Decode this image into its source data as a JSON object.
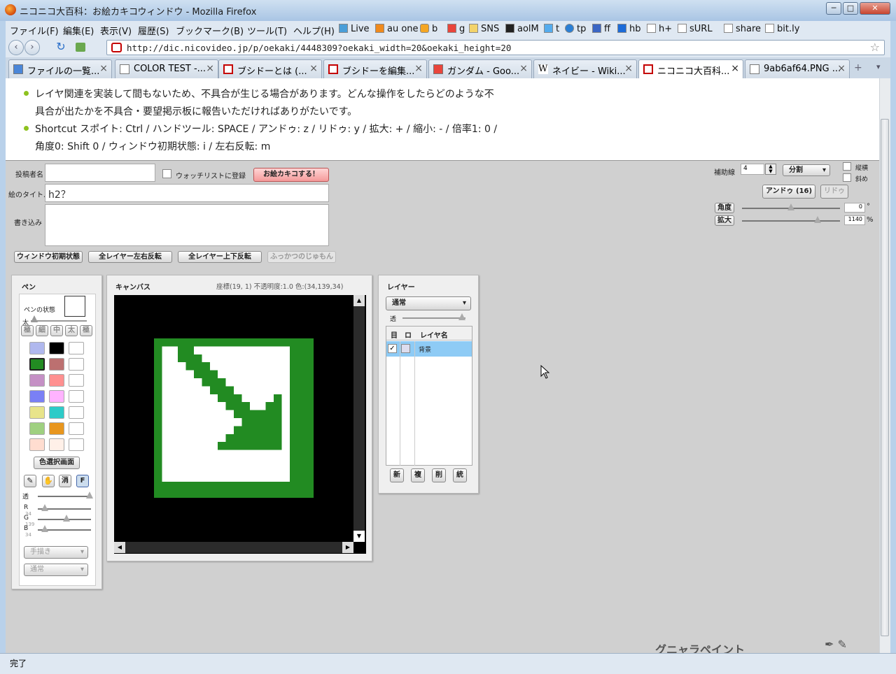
{
  "window": {
    "title": "ニコニコ大百科：お絵カキコウィンドウ - Mozilla Firefox",
    "min": "─",
    "max": "□",
    "close": "✕"
  },
  "menu": [
    {
      "label": "ファイル(F)"
    },
    {
      "label": "編集(E)"
    },
    {
      "label": "表示(V)"
    },
    {
      "label": "履歴(S)"
    },
    {
      "label": "ブックマーク(B)"
    },
    {
      "label": "ツール(T)"
    },
    {
      "label": "ヘルプ(H)"
    }
  ],
  "bookmarks": [
    {
      "label": "Live"
    },
    {
      "label": "au one"
    },
    {
      "label": "b"
    },
    {
      "label": "g"
    },
    {
      "label": "SNS"
    },
    {
      "label": "aolM"
    },
    {
      "label": "t"
    },
    {
      "label": "tp"
    },
    {
      "label": "ff"
    },
    {
      "label": "hb"
    },
    {
      "label": "h+"
    },
    {
      "label": "sURL"
    },
    {
      "label": "share"
    },
    {
      "label": "bit.ly"
    }
  ],
  "nav": {
    "url": "http://dic.nicovideo.jp/p/oekaki/4448309?oekaki_width=20&oekaki_height=20",
    "back": "‹",
    "forward": "›",
    "reload": "↻",
    "star": "☆"
  },
  "tabs": [
    {
      "label": "ファイルの一覧..."
    },
    {
      "label": "COLOR TEST -..."
    },
    {
      "label": "ブシドーとは (..."
    },
    {
      "label": "ブシドーを編集..."
    },
    {
      "label": "ガンダム - Goo..."
    },
    {
      "label": "ネイビー - Wiki..."
    },
    {
      "label": "ニコニコ大百科..."
    },
    {
      "label": "9ab6af64.PNG ..."
    }
  ],
  "info": {
    "line1": "レイヤ関連を実装して間もないため、不具合が生じる場合があります。どんな操作をしたらどのような不",
    "line2": "具合が出たかを不具合・要望掲示板に報告いただければありがたいです。",
    "line3": "Shortcut スポイト: Ctrl / ハンドツール: SPACE / アンドゥ: z / リドゥ: y / 拡大: + / 縮小: - / 倍率1: 0 /",
    "line4": "角度0: Shift 0 / ウィンドウ初期状態: i / 左右反転: m"
  },
  "form": {
    "poster_label": "投稿者名",
    "watchlist_label": "ウォッチリストに登録",
    "submit": "お絵カキコする！",
    "title_label": "絵のタイトル",
    "title_value": "h2？",
    "comment_label": "書き込み",
    "btn_reset": "ウィンドウ初期状態",
    "btn_flip_h": "全レイヤー左右反転",
    "btn_flip_v": "全レイヤー上下反転",
    "btn_revive": "ふっかつのじゅもん"
  },
  "view": {
    "guide_label": "補助線",
    "guide_value": "4",
    "guide_mode": "分割",
    "opt1": "縦横",
    "opt2": "斜め",
    "undo": "アンドゥ (16)",
    "redo": "リドゥ",
    "angle_label": "角度",
    "angle_value": "0",
    "angle_unit": "°",
    "zoom_label": "拡大",
    "zoom_value": "1140",
    "zoom_unit": "%",
    "angle_level": 0.5,
    "zoom_level": 0.77
  },
  "pen": {
    "title": "ペン",
    "state_label": "ペンの状態",
    "size_label": "太",
    "sizes": [
      "極",
      "細",
      "中",
      "太",
      "極"
    ],
    "colors": [
      "#b0b8ee",
      "#000000",
      "#ffffff",
      "#228b22",
      "#bc7070",
      "#ffffff",
      "#c590c5",
      "#ff9090",
      "#ffffff",
      "#7a80f5",
      "#ffb3ff",
      "#ffffff",
      "#e8e48a",
      "#2ecbc8",
      "#ffffff",
      "#9fd080",
      "#e8961e",
      "#ffffff",
      "#ffddd0",
      "#fff0e8",
      "#ffffff"
    ],
    "color_select": "色選択画面",
    "tools": [
      "✎",
      "✋",
      "消",
      "F"
    ],
    "alpha_label": "透",
    "r_label": "R",
    "g_label": "G",
    "b_label": "B",
    "r_value": "34",
    "g_value": "139",
    "b_value": "34",
    "mode": "手描き",
    "blend": "通常"
  },
  "canvas": {
    "title": "キャンバス",
    "status": "座標(19, 1) 不透明度:1.0 色:(34,139,34)",
    "grid": 20,
    "green": "#228b22",
    "white": "#ffffff",
    "arrow_cells": [
      [
        3,
        1
      ],
      [
        4,
        1
      ],
      [
        3,
        2
      ],
      [
        4,
        2
      ],
      [
        5,
        2
      ],
      [
        4,
        3
      ],
      [
        5,
        3
      ],
      [
        6,
        3
      ],
      [
        5,
        4
      ],
      [
        6,
        4
      ],
      [
        7,
        4
      ],
      [
        6,
        5
      ],
      [
        7,
        5
      ],
      [
        8,
        5
      ],
      [
        7,
        6
      ],
      [
        8,
        6
      ],
      [
        9,
        6
      ],
      [
        8,
        7
      ],
      [
        9,
        7
      ],
      [
        10,
        7
      ],
      [
        9,
        8
      ],
      [
        10,
        8
      ],
      [
        11,
        8
      ],
      [
        15,
        7
      ],
      [
        15,
        8
      ],
      [
        14,
        8
      ],
      [
        15,
        9
      ],
      [
        14,
        9
      ],
      [
        13,
        9
      ],
      [
        12,
        9
      ],
      [
        11,
        9
      ],
      [
        10,
        9
      ],
      [
        15,
        10
      ],
      [
        14,
        10
      ],
      [
        13,
        10
      ],
      [
        12,
        10
      ],
      [
        11,
        10
      ],
      [
        15,
        11
      ],
      [
        14,
        11
      ],
      [
        13,
        11
      ],
      [
        12,
        11
      ],
      [
        11,
        11
      ],
      [
        10,
        11
      ],
      [
        15,
        12
      ],
      [
        14,
        12
      ],
      [
        13,
        12
      ],
      [
        12,
        12
      ],
      [
        11,
        12
      ],
      [
        10,
        12
      ],
      [
        9,
        12
      ],
      [
        15,
        13
      ],
      [
        14,
        13
      ],
      [
        13,
        13
      ],
      [
        12,
        13
      ],
      [
        11,
        13
      ],
      [
        10,
        13
      ],
      [
        9,
        13
      ],
      [
        8,
        13
      ]
    ]
  },
  "layer": {
    "title": "レイヤー",
    "blend": "通常",
    "alpha_label": "透",
    "col_eye": "目",
    "col_lock": "ロ",
    "col_name": "レイヤ名",
    "row_name": "背景",
    "buttons": [
      "新",
      "複",
      "削",
      "統"
    ]
  },
  "brand": "グニャラペイント",
  "status": "完了"
}
